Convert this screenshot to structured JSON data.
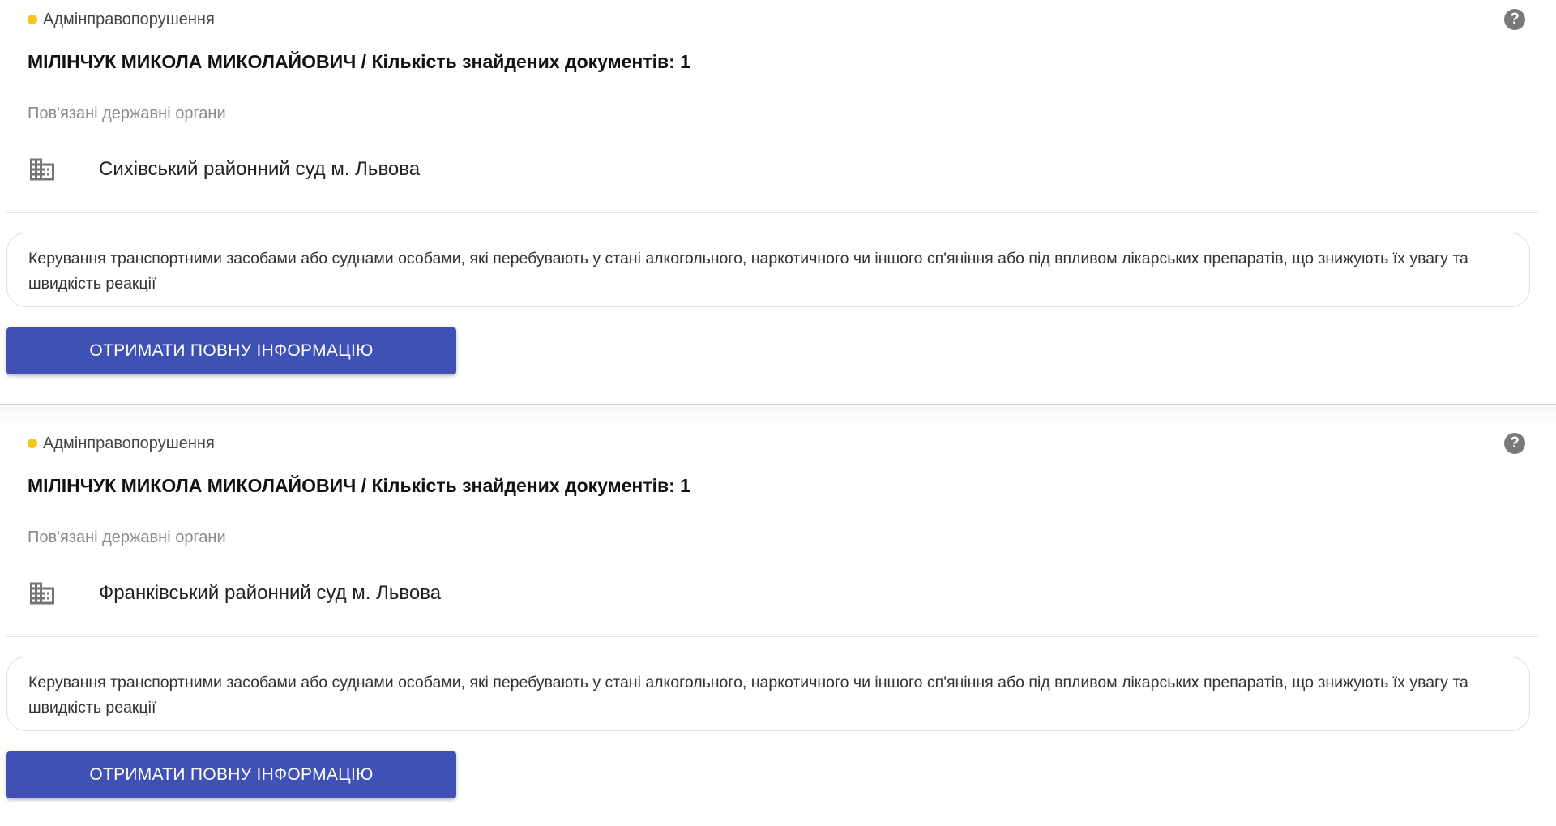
{
  "results": [
    {
      "category": "Адмінправопорушення",
      "category_color": "#f5c518",
      "help_icon": "help-circle-icon",
      "title": "МІЛІНЧУК МИКОЛА МИКОЛАЙОВИЧ / Кількість знайдених документів: 1",
      "organs_label": "Пов'язані державні органи",
      "organ_icon": "building-icon",
      "organ_name": "Сихівський районний суд м. Львова",
      "description": "Керування транспортними засобами або суднами особами, які перебувають у стані алкогольного, наркотичного чи іншого сп'яніння або під впливом лікарських препаратів, що знижують їх увагу та швидкість реакції",
      "button_label": "ОТРИМАТИ ПОВНУ ІНФОРМАЦІЮ"
    },
    {
      "category": "Адмінправопорушення",
      "category_color": "#f5c518",
      "help_icon": "help-circle-icon",
      "title": "МІЛІНЧУК МИКОЛА МИКОЛАЙОВИЧ / Кількість знайдених документів: 1",
      "organs_label": "Пов'язані державні органи",
      "organ_icon": "building-icon",
      "organ_name": "Франківський районний суд м. Львова",
      "description": "Керування транспортними засобами або суднами особами, які перебувають у стані алкогольного, наркотичного чи іншого сп'яніння або під впливом лікарських препаратів, що знижують їх увагу та швидкість реакції",
      "button_label": "ОТРИМАТИ ПОВНУ ІНФОРМАЦІЮ"
    }
  ],
  "colors": {
    "accent": "#3f51b5",
    "category_dot": "#f5c518",
    "help_icon": "#7a7a7a"
  }
}
